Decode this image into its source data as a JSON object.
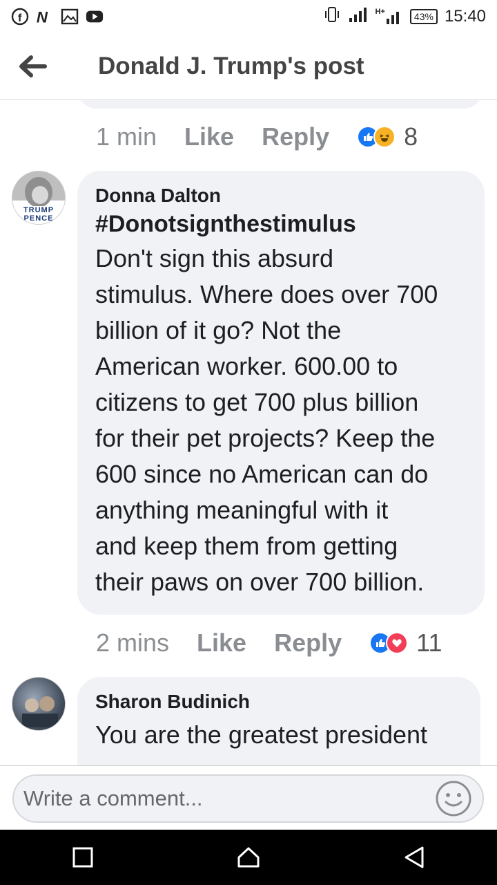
{
  "status_bar": {
    "left_icons": [
      "facebook-icon",
      "n-app-icon",
      "gallery-icon",
      "youtube-icon"
    ],
    "signal_label": "H+",
    "battery": "43%",
    "time": "15:40"
  },
  "header": {
    "title": "Donald J. Trump's post"
  },
  "comments": [
    {
      "meta": {
        "time": "1 min",
        "like": "Like",
        "reply": "Reply",
        "reactions": [
          "like",
          "haha"
        ],
        "count": "8"
      }
    },
    {
      "author": "Donna Dalton",
      "avatar_text": "TRUMP PENCE",
      "hashtag": "#Donotsignthestimulus",
      "lines": [
        "Don't sign this absurd",
        "stimulus. Where does over 700",
        "billion of it go? Not the",
        "American worker. 600.00 to",
        "citizens to get 700 plus billion",
        "for their pet projects? Keep the",
        "600 since no American can do",
        "anything meaningful with it",
        "and keep them from getting",
        "their paws on over 700 billion."
      ],
      "meta": {
        "time": "2 mins",
        "like": "Like",
        "reply": "Reply",
        "reactions": [
          "like",
          "love"
        ],
        "count": "11"
      }
    },
    {
      "author": "Sharon Budinich",
      "text": "You are the greatest president"
    }
  ],
  "composer": {
    "placeholder": "Write a comment..."
  },
  "colors": {
    "bubble": "#f0f2f5",
    "like": "#1877f2",
    "love": "#f33e58",
    "haha": "#f7b125"
  }
}
